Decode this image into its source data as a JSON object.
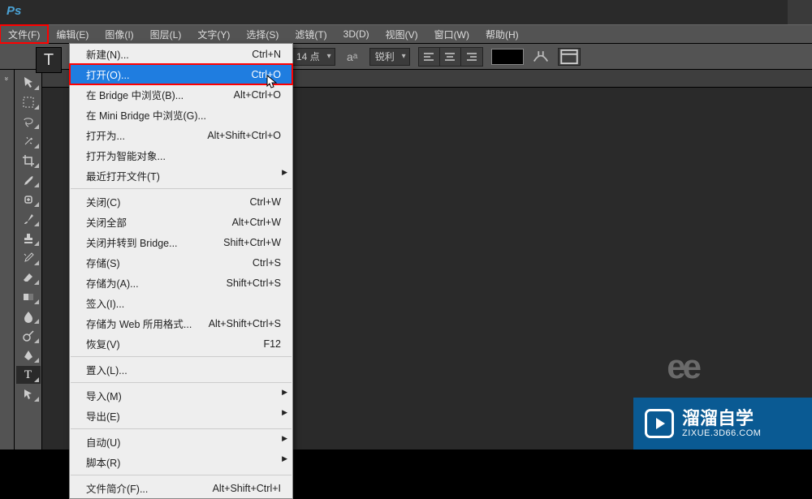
{
  "menubar": {
    "items": [
      {
        "label": "文件(F)",
        "highlighted": true
      },
      {
        "label": "编辑(E)"
      },
      {
        "label": "图像(I)"
      },
      {
        "label": "图层(L)"
      },
      {
        "label": "文字(Y)"
      },
      {
        "label": "选择(S)"
      },
      {
        "label": "滤镜(T)"
      },
      {
        "label": "3D(D)"
      },
      {
        "label": "视图(V)"
      },
      {
        "label": "窗口(W)"
      },
      {
        "label": "帮助(H)"
      }
    ]
  },
  "optionsbar": {
    "font_size": "14 点",
    "aa_label": "a",
    "aa_sub": "a",
    "sharp": "锐利"
  },
  "dropdown": {
    "groups": [
      [
        {
          "label": "新建(N)...",
          "shortcut": "Ctrl+N"
        },
        {
          "label": "打开(O)...",
          "shortcut": "Ctrl+O",
          "highlight": true,
          "redbox": true
        },
        {
          "label": "在 Bridge 中浏览(B)...",
          "shortcut": "Alt+Ctrl+O"
        },
        {
          "label": "在 Mini Bridge 中浏览(G)..."
        },
        {
          "label": "打开为...",
          "shortcut": "Alt+Shift+Ctrl+O"
        },
        {
          "label": "打开为智能对象..."
        },
        {
          "label": "最近打开文件(T)",
          "submenu": true
        }
      ],
      [
        {
          "label": "关闭(C)",
          "shortcut": "Ctrl+W"
        },
        {
          "label": "关闭全部",
          "shortcut": "Alt+Ctrl+W"
        },
        {
          "label": "关闭并转到 Bridge...",
          "shortcut": "Shift+Ctrl+W"
        },
        {
          "label": "存储(S)",
          "shortcut": "Ctrl+S"
        },
        {
          "label": "存储为(A)...",
          "shortcut": "Shift+Ctrl+S"
        },
        {
          "label": "签入(I)..."
        },
        {
          "label": "存储为 Web 所用格式...",
          "shortcut": "Alt+Shift+Ctrl+S"
        },
        {
          "label": "恢复(V)",
          "shortcut": "F12"
        }
      ],
      [
        {
          "label": "置入(L)..."
        }
      ],
      [
        {
          "label": "导入(M)",
          "submenu": true
        },
        {
          "label": "导出(E)",
          "submenu": true
        }
      ],
      [
        {
          "label": "自动(U)",
          "submenu": true
        },
        {
          "label": "脚本(R)",
          "submenu": true
        }
      ],
      [
        {
          "label": "文件简介(F)...",
          "shortcut": "Alt+Shift+Ctrl+I"
        }
      ]
    ]
  },
  "watermark": {
    "main": "溜溜自学",
    "sub": "ZIXUE.3D66.COM"
  }
}
